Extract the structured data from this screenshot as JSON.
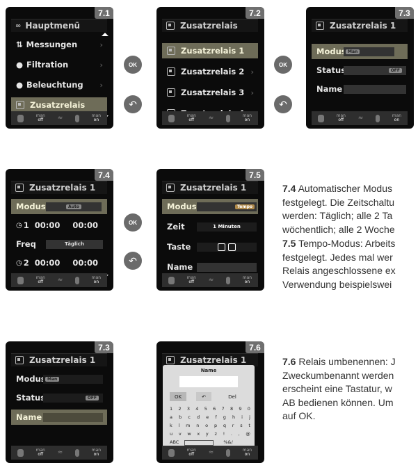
{
  "footer": {
    "left_label": "man",
    "left_state": "off",
    "right_label": "man",
    "right_state": "on"
  },
  "screens": {
    "s71": {
      "badge": "7.1",
      "title": "Hauptmenü",
      "items": [
        {
          "label": "Messungen"
        },
        {
          "label": "Filtration"
        },
        {
          "label": "Beleuchtung"
        },
        {
          "label": "Zusatzrelais"
        }
      ]
    },
    "s72": {
      "badge": "7.2",
      "title": "Zusatzrelais",
      "items": [
        {
          "label": "Zusatzrelais 1"
        },
        {
          "label": "Zusatzrelais 2"
        },
        {
          "label": "Zusatzrelais 3"
        },
        {
          "label": "Zusatzrelais 4"
        }
      ]
    },
    "s73a": {
      "badge": "7.3",
      "title": "Zusatzrelais 1",
      "modus_label": "Modus",
      "modus_value": "Man",
      "status_label": "Status",
      "status_value": "OFF",
      "name_label": "Name"
    },
    "s74": {
      "badge": "7.4",
      "title": "Zusatzrelais 1",
      "modus_label": "Modus",
      "modus_value": "Auto",
      "t1_num": "1",
      "t1_start": "00:00",
      "t1_end": "00:00",
      "freq_label": "Freq",
      "freq_value": "Täglich",
      "t2_num": "2",
      "t2_start": "00:00",
      "t2_end": "00:00"
    },
    "s75": {
      "badge": "7.5",
      "title": "Zusatzrelais 1",
      "modus_label": "Modus",
      "modus_value": "Tempo",
      "zeit_label": "Zeit",
      "zeit_value": "1 Minuten",
      "taste_label": "Taste",
      "name_label": "Name"
    },
    "s73b": {
      "badge": "7.3",
      "title": "Zusatzrelais 1",
      "modus_label": "Modus",
      "modus_value": "Man",
      "status_label": "Status",
      "status_value": "OFF",
      "name_label": "Name"
    },
    "s76": {
      "badge": "7.6",
      "title": "Zusatzrelais 1",
      "kb_title": "Name",
      "ok": "OK",
      "del": "Del",
      "keys": [
        [
          "1",
          "2",
          "3",
          "4",
          "5",
          "6",
          "7",
          "8",
          "9",
          "0"
        ],
        [
          "a",
          "b",
          "c",
          "d",
          "e",
          "f",
          "g",
          "h",
          "i",
          "j"
        ],
        [
          "k",
          "l",
          "m",
          "n",
          "o",
          "p",
          "q",
          "r",
          "s",
          "t"
        ],
        [
          "u",
          "v",
          "w",
          "x",
          "y",
          "z",
          "!",
          ".",
          ",",
          "@"
        ]
      ],
      "abc": "ABC",
      "sym": "%&/"
    }
  },
  "nav": {
    "ok_label": "OK"
  },
  "text": {
    "p74_heading": "7.4",
    "p74_lines": [
      "Automatischer Modus",
      "festgelegt. Die Zeitschaltu",
      "werden: Täglich; alle 2 Ta",
      "wöchentlich; alle 2 Woche"
    ],
    "p75_heading": "7.5",
    "p75_lines": [
      "Tempo-Modus: Arbeits",
      "festgelegt. Jedes mal wer",
      "Relais angeschlossene ex",
      "Verwendung beispielswei"
    ],
    "p76_heading": "7.6",
    "p76_lines": [
      "Relais umbenennen: J",
      "Zweckumbenannt werden",
      "erscheint eine Tastatur, w",
      "AB bedienen können. Um",
      "auf OK."
    ]
  }
}
